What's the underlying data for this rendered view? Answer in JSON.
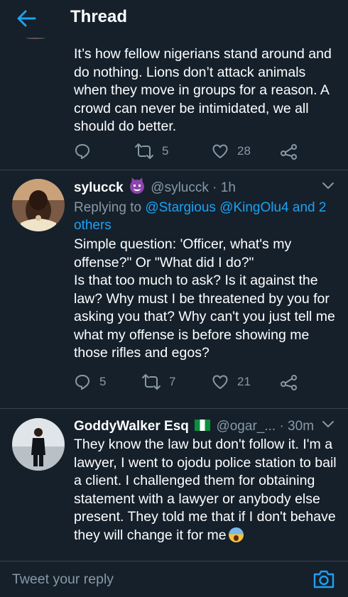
{
  "header": {
    "title": "Thread",
    "back_icon": "arrow-left-icon"
  },
  "tweets": [
    {
      "text": "It’s how fellow nigerians stand around and do nothing. Lions don’t attack animals when they move in groups for a reason. A crowd can never be intimidated, we all should do better.",
      "actions": {
        "reply": "",
        "retweet": "5",
        "like": "28"
      }
    },
    {
      "name": "sylucck",
      "handle": "@sylucck",
      "time": "· 1h",
      "replying_label": "Replying to",
      "replying_to": "@Stargious @KingOlu4 and 2 others",
      "text": "Simple question: 'Officer, what's my offense?\" Or \"What did I do?\"\nIs that too much to ask? Is it against the law? Why must I be threatened by you for asking you that? Why can't you just tell me what my offense is before showing me those rifles and egos?",
      "actions": {
        "reply": "5",
        "retweet": "7",
        "like": "21"
      }
    },
    {
      "name": "GoddyWalker Esq",
      "handle": "@ogar_...",
      "time": "· 30m",
      "text": "They know the law but don't follow it. I'm a lawyer, I went to ojodu police station to bail a client. I challenged them for obtaining statement with a lawyer or anybody else present. They told me that if I don't behave they will change it for me"
    }
  ],
  "compose": {
    "placeholder": "Tweet your reply"
  },
  "colors": {
    "background": "#15202b",
    "accent": "#1da1f2",
    "muted": "#8899a6",
    "divider": "#38444d"
  }
}
